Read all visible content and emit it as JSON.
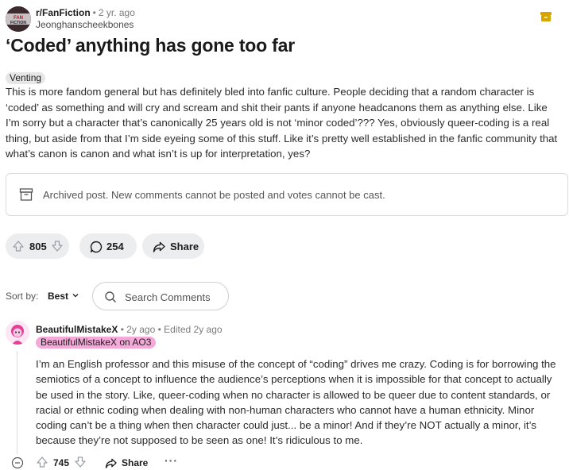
{
  "post": {
    "subreddit": "r/FanFiction",
    "time": "2 yr. ago",
    "author": "Jeonghanscheekbones",
    "title": "‘Coded’ anything has gone too far",
    "flair": "Venting",
    "body": "This is more fandom general but has definitely bled into fanfic culture. People deciding that a random character is ‘coded’ as something and will cry and scream and shit their pants if anyone headcanons them as anything else. Like I’m sorry but a character that’s canonically 25 years old is not ‘minor coded’??? Yes, obviously queer-coding is a real thing, but aside from that I’m side eyeing some of this stuff. Like it’s pretty well established in the fanfic community that what’s canon is canon and what isn’t is up for interpretation, yes?",
    "archived_notice": "Archived post. New comments cannot be posted and votes cannot be cast.",
    "votes": "805",
    "comments": "254",
    "share_label": "Share"
  },
  "sort": {
    "label": "Sort by:",
    "value": "Best",
    "search_placeholder": "Search Comments"
  },
  "comment": {
    "author": "BeautifulMistakeX",
    "time": "2y ago",
    "edited": "Edited 2y ago",
    "flair": "BeautifulMistakeX on AO3",
    "body": "I’m an English professor and this misuse of the concept of “coding” drives me crazy. Coding is for borrowing the semiotics of a concept to influence the audience’s perceptions when it is impossible for that concept to actually be used in the story. Like, queer-coding when no character is allowed to be queer due to content standards, or racial or ethnic coding when dealing with non-human characters who cannot have a human ethnicity. Minor coding can’t be a thing when then character could just... be a minor! And if they’re NOT actually a minor, it’s because they’re not supposed to be seen as one! It’s ridiculous to me.",
    "votes": "745",
    "share_label": "Share",
    "more": "···"
  },
  "colors": {
    "pill_bg": "#ebedef",
    "flair_bg": "#e6e6e6",
    "comment_flair_bg": "#f5a9d8",
    "archive_icon": "#d6a500"
  },
  "icons": [
    "subreddit-avatar",
    "archive-box-icon",
    "upvote-icon",
    "downvote-icon",
    "comment-bubble-icon",
    "share-arrow-icon",
    "chevron-down-icon",
    "search-icon",
    "collapse-icon",
    "more-icon"
  ]
}
